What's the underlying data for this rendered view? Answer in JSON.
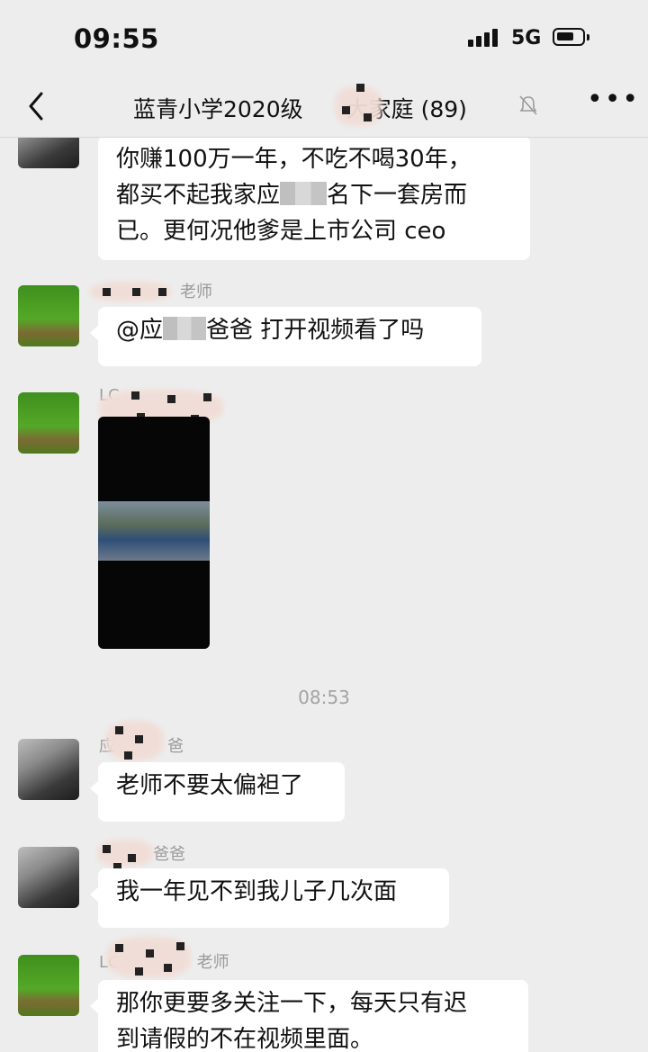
{
  "status_bar": {
    "time": "09:55",
    "network": "5G"
  },
  "nav": {
    "title": "蓝青小学2020级",
    "title_tail": "大家庭 (89)"
  },
  "timestamp": "08:53",
  "messages": [
    {
      "lines": [
        "你赚100万一年，不吃不喝30年，",
        "都买不起我家应",
        "名下一套房而",
        "已。更何况他爹是上市公司 ceo"
      ]
    },
    {
      "sender_visible": "老师",
      "text_pre": "@应",
      "text_post": "爸爸 打开视频看了吗"
    },
    {
      "sender_visible": "LC",
      "type": "video"
    },
    {
      "sender_visible": "应",
      "sender_tail": "爸",
      "text": "老师不要太偏袒了"
    },
    {
      "sender_tail": "爸爸",
      "text": "我一年见不到我儿子几次面"
    },
    {
      "sender_visible": "LC",
      "sender_tail": "老师",
      "lines": [
        "那你更要多关注一下，每天只有迟",
        "到请假的不在视频里面。"
      ]
    }
  ]
}
